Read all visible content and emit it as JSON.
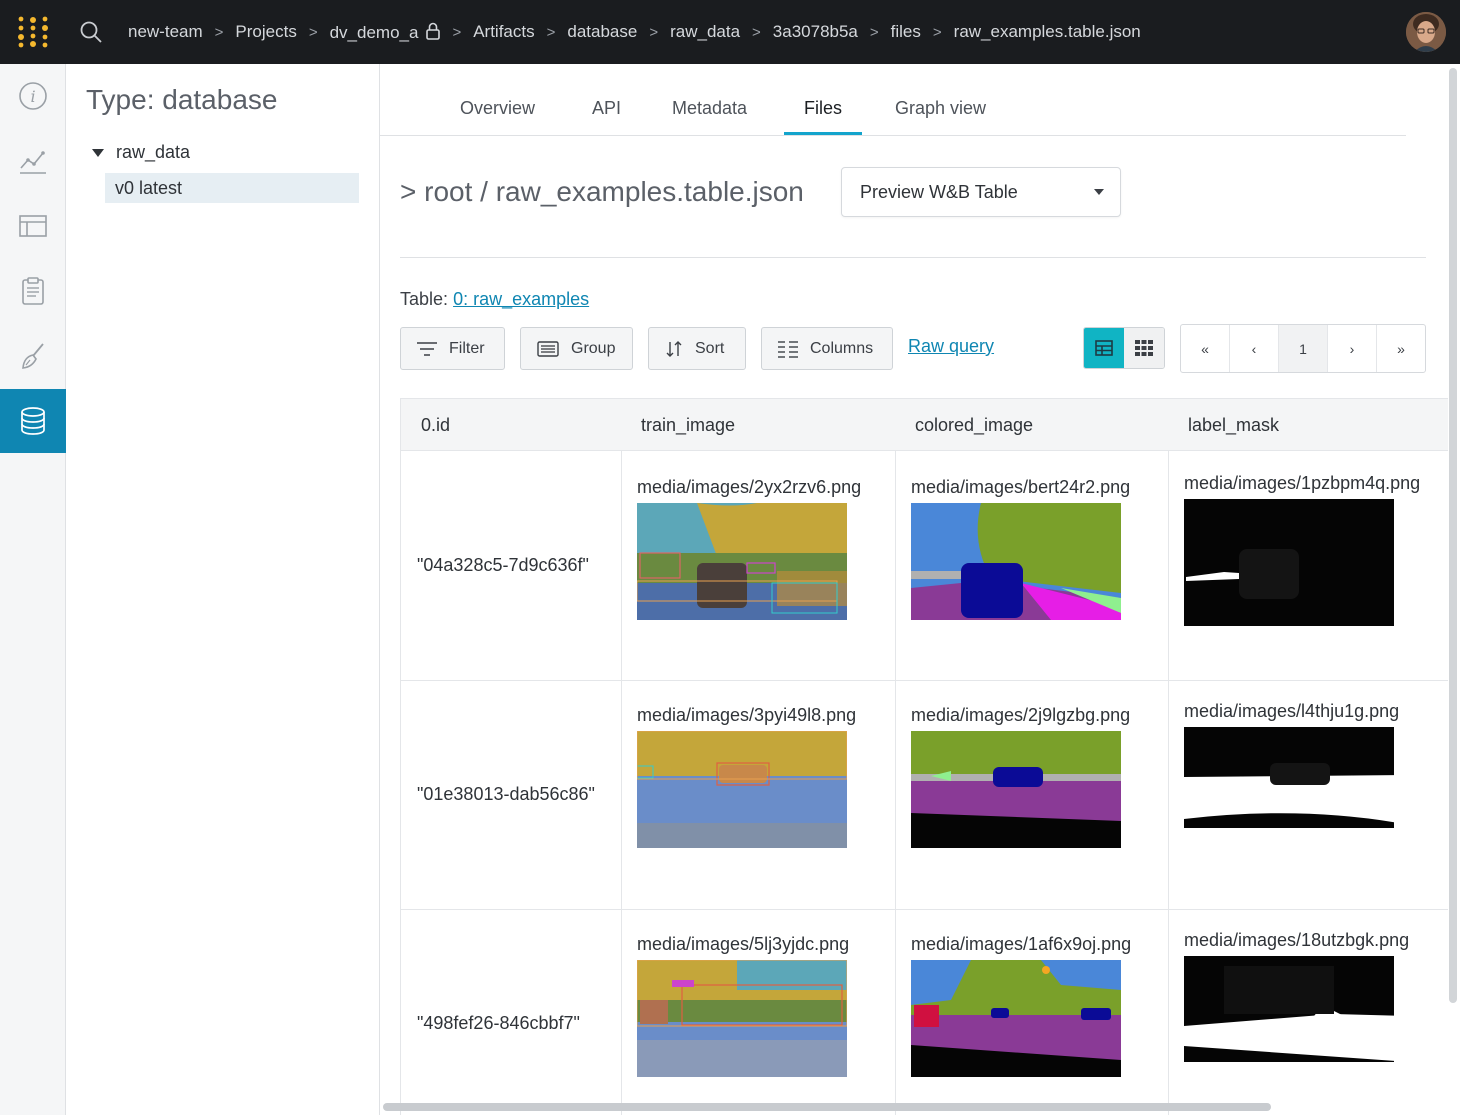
{
  "breadcrumb": {
    "items": [
      "new-team",
      "Projects",
      "dv_demo_a",
      "Artifacts",
      "database",
      "raw_data",
      "3a3078b5a",
      "files",
      "raw_examples.table.json"
    ]
  },
  "rail": {
    "items": [
      "info-icon",
      "chart-line-icon",
      "table-icon",
      "report-icon",
      "brush-icon",
      "database-icon"
    ],
    "active": "database-icon"
  },
  "tree": {
    "title": "Type: database",
    "node": "raw_data",
    "leaf": "v0 latest"
  },
  "tabs": [
    "Overview",
    "API",
    "Metadata",
    "Files",
    "Graph view"
  ],
  "active_tab": "Files",
  "path_title": "> root / raw_examples.table.json",
  "preview_select": "Preview W&B Table",
  "table_label": {
    "prefix": "Table:",
    "link": "0: raw_examples"
  },
  "toolbar": {
    "filter": "Filter",
    "group": "Group",
    "sort": "Sort",
    "columns": "Columns",
    "raw_query": "Raw query"
  },
  "pager": {
    "first": "«",
    "prev": "‹",
    "page": "1",
    "next": "›",
    "last": "»"
  },
  "colors": {
    "accent": "#0f86b2",
    "toggle_on": "#10b4c4",
    "topbar": "#1a1c1f"
  },
  "table": {
    "columns": [
      "0.id",
      "train_image",
      "colored_image",
      "label_mask"
    ],
    "rows": [
      {
        "id": "\"04a328c5-7d9c636f\"",
        "train_image": "media/images/2yx2rzv6.png",
        "colored_image": "media/images/bert24r2.png",
        "label_mask": "media/images/1pzbpm4q.png"
      },
      {
        "id": "\"01e38013-dab56c86\"",
        "train_image": "media/images/3pyi49l8.png",
        "colored_image": "media/images/2j9lgzbg.png",
        "label_mask": "media/images/l4thju1g.png"
      },
      {
        "id": "\"498fef26-846cbbf7\"",
        "train_image": "media/images/5lj3yjdc.png",
        "colored_image": "media/images/1af6x9oj.png",
        "label_mask": "media/images/18utzbgk.png"
      }
    ]
  }
}
